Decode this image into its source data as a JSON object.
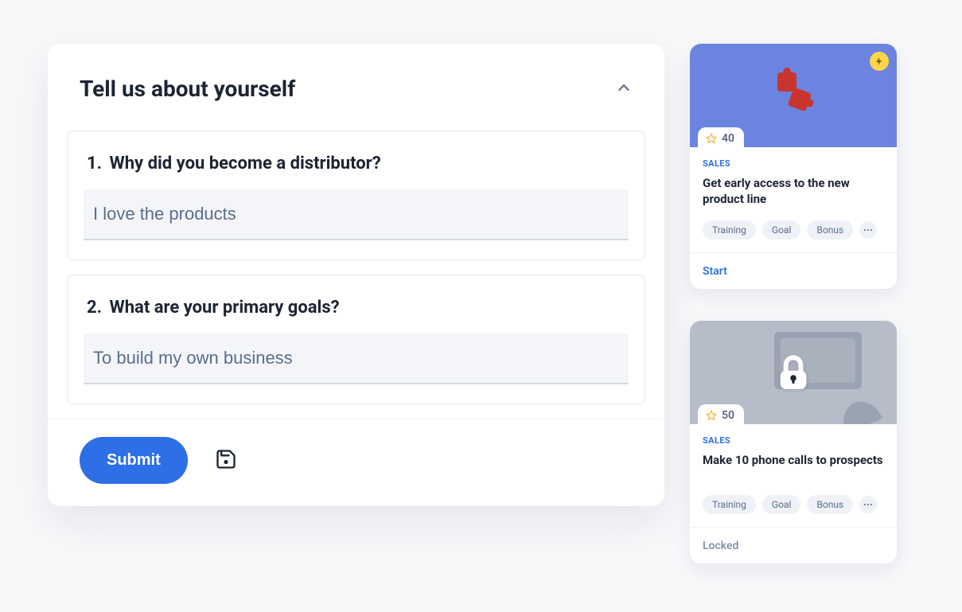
{
  "form": {
    "title": "Tell us about yourself",
    "questions": [
      {
        "num": "1.",
        "text": "Why did you become a distributor?",
        "value": "I love the products"
      },
      {
        "num": "2.",
        "text": "What are your primary goals?",
        "value": "To build my own business"
      }
    ],
    "submit_label": "Submit"
  },
  "cards": [
    {
      "points": "40",
      "category": "SALES",
      "title": "Get early access to the new product line",
      "tags": [
        "Training",
        "Goal",
        "Bonus"
      ],
      "action": "Start",
      "locked": false
    },
    {
      "points": "50",
      "category": "SALES",
      "title": "Make 10 phone calls to prospects",
      "tags": [
        "Training",
        "Goal",
        "Bonus"
      ],
      "action": "Locked",
      "locked": true
    }
  ]
}
